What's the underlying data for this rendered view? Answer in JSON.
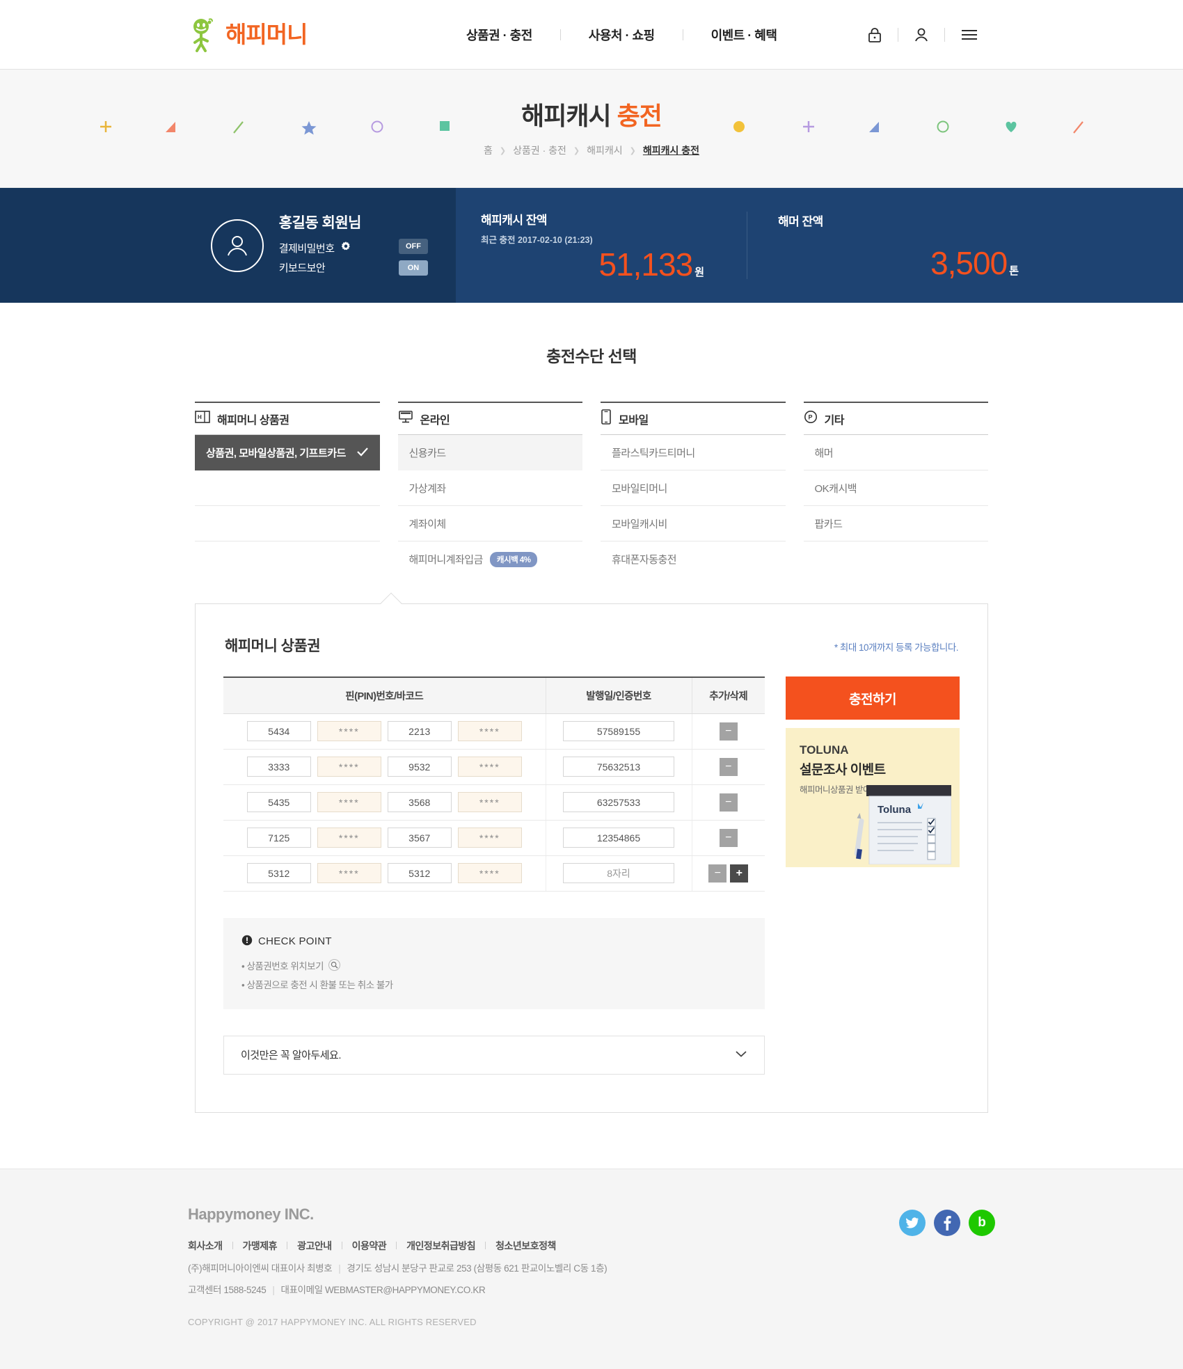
{
  "header": {
    "logo_text": "해피머니",
    "nav": [
      {
        "label": "상품권 · 충전"
      },
      {
        "label": "사용처 · 쇼핑"
      },
      {
        "label": "이벤트 · 혜택"
      }
    ],
    "icons": [
      {
        "name": "lock-icon"
      },
      {
        "name": "user-icon"
      },
      {
        "name": "menu-icon"
      }
    ]
  },
  "hero": {
    "title_main": "해피캐시 ",
    "title_accent": "충전",
    "breadcrumb": [
      {
        "label": "홈",
        "current": false
      },
      {
        "label": "상품권 · 충전",
        "current": false
      },
      {
        "label": "해피캐시",
        "current": false
      },
      {
        "label": "해피캐시 충전",
        "current": true
      }
    ],
    "decorations": [
      {
        "shape": "plus",
        "color": "#e8b53a"
      },
      {
        "shape": "triangle",
        "color": "#f2866a"
      },
      {
        "shape": "slash",
        "color": "#8ec36a"
      },
      {
        "shape": "star",
        "color": "#7b97d4"
      },
      {
        "shape": "circle",
        "color": "#b69ae0"
      },
      {
        "shape": "square",
        "color": "#5cc4a0"
      },
      {
        "shape": "dot",
        "color": "#f2c23a"
      },
      {
        "shape": "plus",
        "color": "#b69ae0"
      },
      {
        "shape": "triangle",
        "color": "#7b97d4"
      },
      {
        "shape": "circle",
        "color": "#7cc47c"
      },
      {
        "shape": "heart",
        "color": "#5cc4a0"
      },
      {
        "shape": "slash",
        "color": "#f2866a"
      }
    ]
  },
  "userbar": {
    "member_name": "홍길동 회원님",
    "pay_password_label": "결제비밀번호",
    "keyboard_security_label": "키보드보안",
    "toggle_off": "OFF",
    "toggle_on": "ON",
    "happycash": {
      "label": "해피캐시 잔액",
      "sub": "최근 충전 2017-02-10 (21:23)",
      "value": "51,133",
      "unit": "원"
    },
    "hammer": {
      "label": "해머 잔액",
      "value": "3,500",
      "unit": "톤"
    }
  },
  "section": {
    "title": "충전수단 선택"
  },
  "methods": [
    {
      "icon": "giftcard-icon",
      "head": "해피머니 상품권",
      "items": [
        {
          "label": "상품권, 모바일상품권, 기프트카드",
          "selected": true
        },
        {
          "label": "",
          "blank": true
        },
        {
          "label": "",
          "blank": true
        }
      ]
    },
    {
      "icon": "monitor-icon",
      "head": "온라인",
      "items": [
        {
          "label": "신용카드",
          "shade": true
        },
        {
          "label": "가상계좌"
        },
        {
          "label": "계좌이체"
        },
        {
          "label": "해피머니계좌입금",
          "badge": "캐시백 4%"
        }
      ]
    },
    {
      "icon": "mobile-icon",
      "head": "모바일",
      "items": [
        {
          "label": "플라스틱카드티머니"
        },
        {
          "label": "모바일티머니"
        },
        {
          "label": "모바일캐시비"
        },
        {
          "label": "휴대폰자동충전"
        }
      ]
    },
    {
      "icon": "point-icon",
      "head": "기타",
      "items": [
        {
          "label": "해머"
        },
        {
          "label": "OK캐시백"
        },
        {
          "label": "팝카드"
        },
        {
          "label": "",
          "blank": true
        }
      ]
    }
  ],
  "panel": {
    "title": "해피머니 상품권",
    "note": "* 최대 10개까지 등록 가능합니다.",
    "table": {
      "headers": [
        "핀(PIN)번호/바코드",
        "발행일/인증번호",
        "추가/삭제"
      ],
      "rows": [
        {
          "p1": "5434",
          "p2": "****",
          "p3": "2213",
          "p4": "****",
          "cert": "57589155",
          "cert_placeholder": "",
          "add": false
        },
        {
          "p1": "3333",
          "p2": "****",
          "p3": "9532",
          "p4": "****",
          "cert": "75632513",
          "cert_placeholder": "",
          "add": false
        },
        {
          "p1": "5435",
          "p2": "****",
          "p3": "3568",
          "p4": "****",
          "cert": "63257533",
          "cert_placeholder": "",
          "add": false
        },
        {
          "p1": "7125",
          "p2": "****",
          "p3": "3567",
          "p4": "****",
          "cert": "12354865",
          "cert_placeholder": "",
          "add": false
        },
        {
          "p1": "5312",
          "p2": "****",
          "p3": "5312",
          "p4": "****",
          "cert": "",
          "cert_placeholder": "8자리",
          "add": true
        }
      ],
      "minus_label": "−",
      "plus_label": "+"
    },
    "checkpoint": {
      "title": "CHECK POINT",
      "lines": [
        "• 상품권번호 위치보기",
        "• 상품권으로 충전 시 환불 또는 취소 불가"
      ]
    },
    "accordion_label": "이것만은 꼭 알아두세요.",
    "charge_button": "충전하기",
    "ad": {
      "line1": "TOLUNA",
      "line2": "설문조사 이벤트",
      "line3": "해피머니상품권 받아가세요!",
      "brand": "Toluna"
    }
  },
  "footer": {
    "brand": "Happymoney INC.",
    "links": [
      "회사소개",
      "가맹제휴",
      "광고안내",
      "이용약관",
      "개인정보취급방침",
      "청소년보호정책"
    ],
    "line1_a": "(주)해피머니아이엔씨 대표이사 최병호",
    "line1_b": "경기도 성남시 분당구 판교로 253 (삼평동 621 판교이노벨리 C동 1층)",
    "line2_a": "고객센터 1588-5245",
    "line2_b": "대표이메일 WEBMASTER@HAPPYMONEY.CO.KR",
    "copyright": "COPYRIGHT @ 2017 HAPPYMONEY INC. ALL RIGHTS RESERVED",
    "socials": [
      {
        "name": "twitter-icon",
        "glyph": "t",
        "color": "#4fb3e8"
      },
      {
        "name": "facebook-icon",
        "glyph": "f",
        "color": "#4267b2"
      },
      {
        "name": "naverblog-icon",
        "glyph": "b",
        "color": "#1ec800"
      }
    ]
  }
}
